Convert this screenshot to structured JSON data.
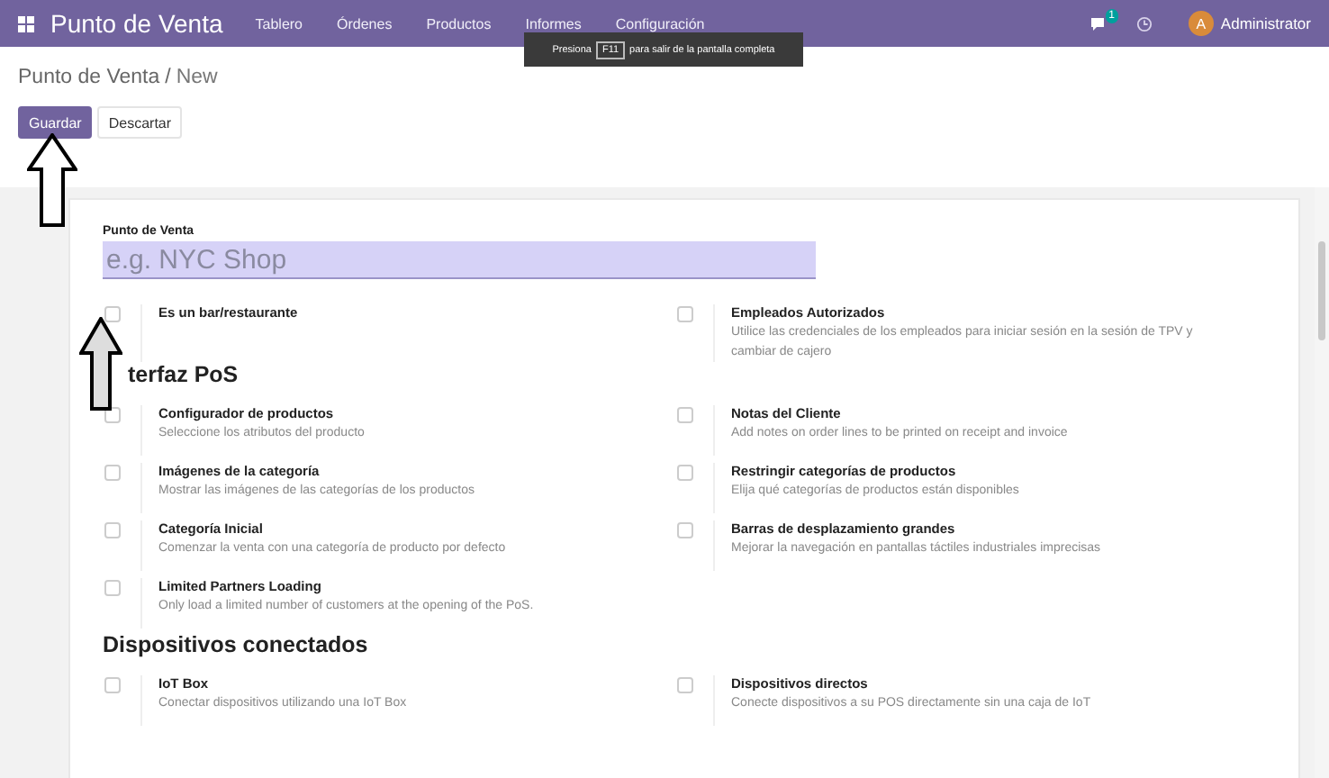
{
  "navbar": {
    "app_name": "Punto de Venta",
    "menu": [
      "Tablero",
      "Órdenes",
      "Productos",
      "Informes",
      "Configuración"
    ],
    "message_count": "1",
    "user": {
      "initial": "A",
      "name": "Administrator"
    }
  },
  "tooltip": {
    "before": "Presiona",
    "key": "F11",
    "after": "para salir de la pantalla completa"
  },
  "breadcrumb": {
    "parent": "Punto de Venta",
    "separator": "/",
    "current": "New"
  },
  "buttons": [
    {
      "label": "Guardar",
      "kind": "primary"
    },
    {
      "label": "Descartar",
      "kind": "secondary"
    }
  ],
  "name_field": {
    "label": "Punto de Venta",
    "placeholder": "e.g. NYC Shop"
  },
  "sections": [
    {
      "settings": [
        {
          "label": "Es un bar/restaurante",
          "checked": false
        },
        {
          "label": "Empleados Autorizados",
          "description": "Utilice las credenciales de los empleados para iniciar sesión en la sesión de TPV y cambiar de cajero",
          "checked": false
        }
      ]
    },
    {
      "title": "terfaz PoS",
      "settings": [
        {
          "label": "Configurador de productos",
          "description": "Seleccione los atributos del producto",
          "checked": false
        },
        {
          "label": "Notas del Cliente",
          "description": "Add notes on order lines to be printed on receipt and invoice",
          "checked": false
        },
        {
          "label": "Imágenes de la categoría",
          "description": "Mostrar las imágenes de las categorías de los productos",
          "checked": false
        },
        {
          "label": "Restringir categorías de productos",
          "description": "Elija qué categorías de productos están disponibles",
          "checked": false
        },
        {
          "label": "Categoría Inicial",
          "description": "Comenzar la venta con una categoría de producto por defecto",
          "checked": false
        },
        {
          "label": "Barras de desplazamiento grandes",
          "description": "Mejorar la navegación en pantallas táctiles industriales imprecisas",
          "checked": false
        },
        {
          "label": "Limited Partners Loading",
          "description": "Only load a limited number of customers at the opening of the PoS.",
          "checked": false
        }
      ]
    },
    {
      "title": "Dispositivos conectados",
      "settings": [
        {
          "label": "IoT Box",
          "description": "Conectar dispositivos utilizando una IoT Box",
          "checked": false
        },
        {
          "label": "Dispositivos directos",
          "description": "Conecte dispositivos a su POS directamente sin una caja de IoT",
          "checked": false
        }
      ]
    }
  ]
}
